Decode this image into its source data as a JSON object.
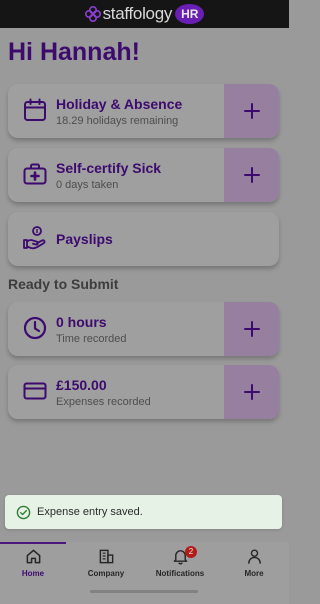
{
  "app": {
    "logo_text": "staffology",
    "logo_badge": "HR"
  },
  "greeting": "Hi Hannah!",
  "cards": [
    {
      "title": "Holiday & Absence",
      "subtitle": "18.29 holidays remaining",
      "icon": "calendar-icon"
    },
    {
      "title": "Self-certify Sick",
      "subtitle": "0 days taken",
      "icon": "medical-kit-icon"
    },
    {
      "title": "Payslips",
      "icon": "hand-money-icon"
    }
  ],
  "section_title": "Ready to Submit",
  "submit_cards": [
    {
      "title": "0 hours",
      "subtitle": "Time recorded",
      "icon": "clock-icon"
    },
    {
      "title": "£150.00",
      "subtitle": "Expenses recorded",
      "icon": "credit-card-icon"
    }
  ],
  "toast": {
    "message": "Expense entry saved."
  },
  "nav": {
    "items": [
      {
        "label": "Home"
      },
      {
        "label": "Company"
      },
      {
        "label": "Notifications",
        "badge": "2"
      },
      {
        "label": "More"
      }
    ]
  },
  "colors": {
    "brand_purple": "#3d0a6e",
    "accent_purple": "#6a1fb4",
    "toast_bg": "#e6f2e6",
    "success_green": "#2e7d32",
    "badge_red": "#b31b1b"
  }
}
